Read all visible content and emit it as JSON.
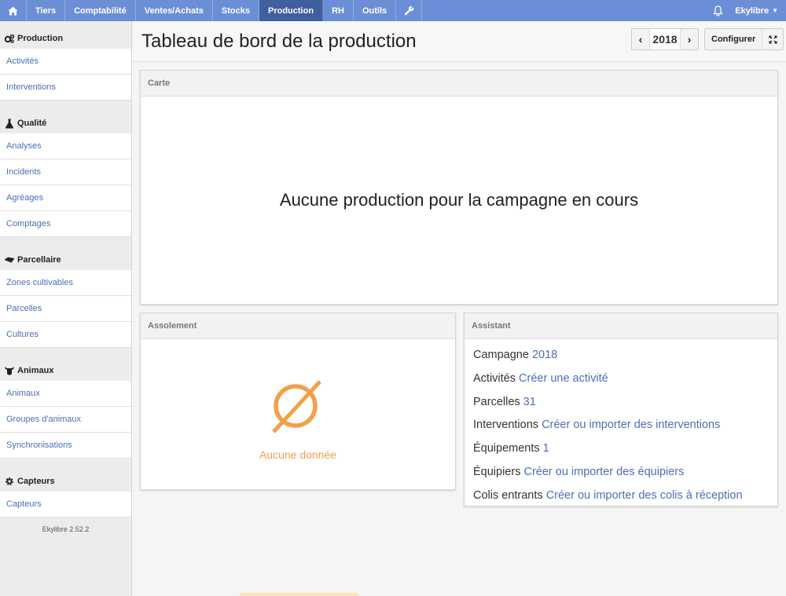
{
  "nav": {
    "home_icon": "home-icon",
    "items": [
      {
        "label": "Tiers"
      },
      {
        "label": "Comptabilité"
      },
      {
        "label": "Ventes/Achats"
      },
      {
        "label": "Stocks"
      },
      {
        "label": "Production"
      },
      {
        "label": "RH"
      },
      {
        "label": "Outils"
      }
    ],
    "active": "Production",
    "settings_icon": "wrench-icon",
    "notifications_icon": "bell-icon",
    "user_label": "Ekylibre",
    "accent": "#6b8fd6",
    "active_color": "#3f5f9f"
  },
  "sidebar": {
    "sections": [
      {
        "title": "Production",
        "icon": "gears-icon",
        "links": [
          "Activités",
          "Interventions"
        ]
      },
      {
        "title": "Qualité",
        "icon": "flask-icon",
        "links": [
          "Analyses",
          "Incidents",
          "Agréages",
          "Comptages"
        ]
      },
      {
        "title": "Parcellaire",
        "icon": "land-plot-icon",
        "links": [
          "Zones cultivables",
          "Parcelles",
          "Cultures"
        ]
      },
      {
        "title": "Animaux",
        "icon": "cow-icon",
        "links": [
          "Animaux",
          "Groupes d'animaux",
          "Synchronisations"
        ]
      },
      {
        "title": "Capteurs",
        "icon": "gear-icon",
        "links": [
          "Capteurs"
        ]
      }
    ],
    "version": "Ekylibre 2.52.2"
  },
  "header": {
    "title": "Tableau de bord de la production",
    "year": "2018",
    "configure_label": "Configurer"
  },
  "carte": {
    "title": "Carte",
    "message": "Aucune production pour la campagne en cours"
  },
  "assolement": {
    "title": "Assolement",
    "empty_text": "Aucune donnée",
    "empty_color": "#f2a04a"
  },
  "assistant": {
    "title": "Assistant",
    "rows": [
      {
        "label": "Campagne",
        "value": "2018"
      },
      {
        "label": "Activités",
        "value": "Créer une activité"
      },
      {
        "label": "Parcelles",
        "value": "31"
      },
      {
        "label": "Interventions",
        "value": "Créer ou importer des interventions"
      },
      {
        "label": "Équipements",
        "value": "1"
      },
      {
        "label": "Équipiers",
        "value": "Créer ou importer des équipiers"
      },
      {
        "label": "Colis entrants",
        "value": "Créer ou importer des colis à réception"
      }
    ],
    "link_color": "#4a6fb8"
  }
}
